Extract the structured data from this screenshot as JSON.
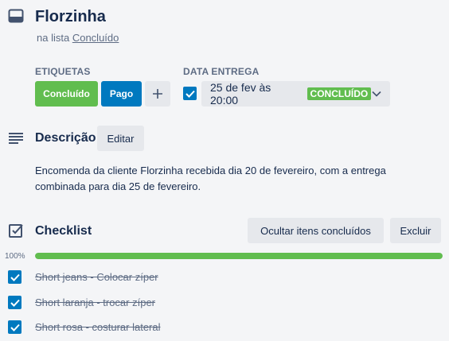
{
  "card": {
    "title": "Florzinha",
    "list_prefix": "na lista",
    "list_name": "Concluído"
  },
  "labels_section": {
    "heading": "ETIQUETAS",
    "labels": [
      {
        "text": "Concluído",
        "color": "#61bd4f"
      },
      {
        "text": "Pago",
        "color": "#0079bf"
      }
    ],
    "add_icon": "plus-icon"
  },
  "due_section": {
    "heading": "DATA ENTREGA",
    "checked": true,
    "date_text": "25 de fev às 20:00",
    "badge": "CONCLUÍDO"
  },
  "description": {
    "heading": "Descrição",
    "edit_label": "Editar",
    "text": "Encomenda da cliente Florzinha recebida dia 20 de fevereiro, com a entrega combinada para dia 25 de fevereiro."
  },
  "checklist": {
    "heading": "Checklist",
    "hide_label": "Ocultar itens concluídos",
    "delete_label": "Excluir",
    "progress_text": "100%",
    "progress": 1.0,
    "items": [
      {
        "text": "Short jeans - Colocar zíper",
        "checked": true
      },
      {
        "text": "Short laranja - trocar zíper",
        "checked": true
      },
      {
        "text": "Short rosa - costurar lateral",
        "checked": true
      }
    ]
  },
  "colors": {
    "green": "#61bd4f",
    "blue": "#0079bf",
    "background": "#f4f5f7"
  }
}
